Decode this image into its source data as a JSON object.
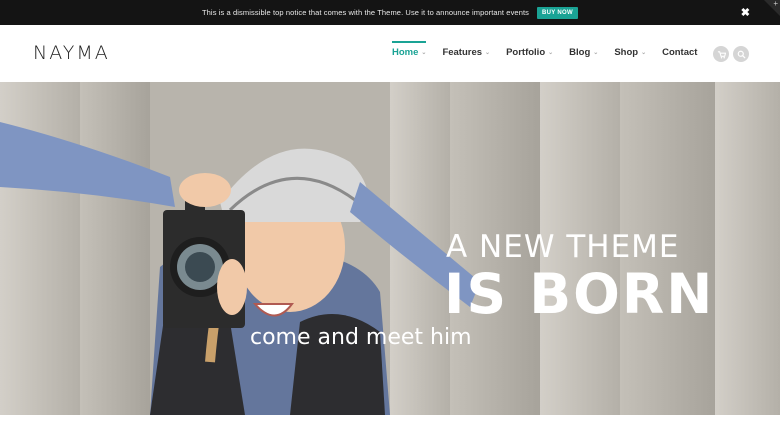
{
  "notice": {
    "text": "This is a dismissible top notice that comes with the Theme. Use it to announce important events",
    "button_label": "BUY NOW",
    "close_glyph": "✖"
  },
  "header": {
    "logo": "NAYMA",
    "nav": [
      {
        "label": "Home",
        "has_dropdown": true,
        "active": true
      },
      {
        "label": "Features",
        "has_dropdown": true,
        "active": false
      },
      {
        "label": "Portfolio",
        "has_dropdown": true,
        "active": false
      },
      {
        "label": "Blog",
        "has_dropdown": true,
        "active": false
      },
      {
        "label": "Shop",
        "has_dropdown": true,
        "active": false
      },
      {
        "label": "Contact",
        "has_dropdown": false,
        "active": false
      }
    ],
    "icons": [
      "cart-icon",
      "search-icon"
    ]
  },
  "hero": {
    "title_line1": "A NEW THEME",
    "title_line2": "IS BORN",
    "subtitle": "come and meet him"
  },
  "colors": {
    "accent": "#1aa395",
    "notice_bg": "#141414"
  }
}
